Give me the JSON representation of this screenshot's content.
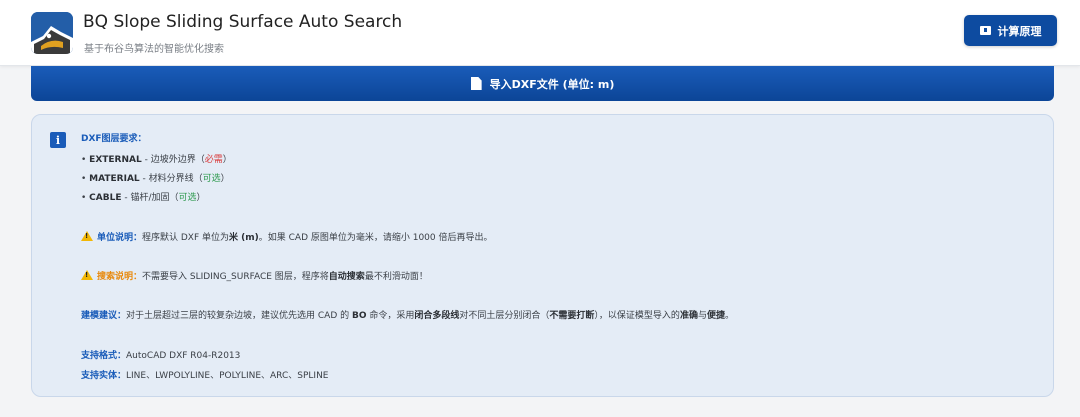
{
  "header": {
    "title": "BQ Slope Sliding Surface Auto Search",
    "subtitle": "基于布谷鸟算法的智能优化搜索",
    "principle_button": "计算原理"
  },
  "import_bar": {
    "label": "导入DXF文件 (单位: m)"
  },
  "info": {
    "layer_title": "DXF图层要求：",
    "layers": [
      {
        "name": "EXTERNAL",
        "desc": " - 边坡外边界（",
        "tag": "必需",
        "close": "）"
      },
      {
        "name": "MATERIAL",
        "desc": " - 材料分界线（",
        "tag": "可选",
        "close": "）"
      },
      {
        "name": "CABLE",
        "desc": " - 锚杆/加固（",
        "tag": "可选",
        "close": "）"
      }
    ],
    "unit_note": {
      "title": "单位说明：",
      "text1": "程序默认 DXF 单位为",
      "bold1": "米 (m)",
      "text2": "。如果 CAD 原图单位为毫米，请缩小 1000 倍后再导出。"
    },
    "search_note": {
      "title": "搜索说明：",
      "text1": "不需要导入 SLIDING_SURFACE 图层，程序将",
      "bold1": "自动搜索",
      "text2": "最不利滑动面！"
    },
    "modeling_note": {
      "title": "建模建议：",
      "text1": "对于土层超过三层的较复杂边坡，建议优先选用 CAD 的 ",
      "bold1": "BO",
      "text2": " 命令，采用",
      "bold2": "闭合多段线",
      "text3": "对不同土层分别闭合（",
      "bold3": "不需要打断",
      "text4": "），以保证模型导入的",
      "bold4": "准确",
      "text5": "与",
      "bold5": "便捷",
      "text6": "。"
    },
    "formats": {
      "title": "支持格式：",
      "text": "AutoCAD DXF R04-R2013"
    },
    "entities": {
      "title": "支持实体：",
      "text": "LINE、LWPOLYLINE、POLYLINE、ARC、SPLINE"
    }
  }
}
